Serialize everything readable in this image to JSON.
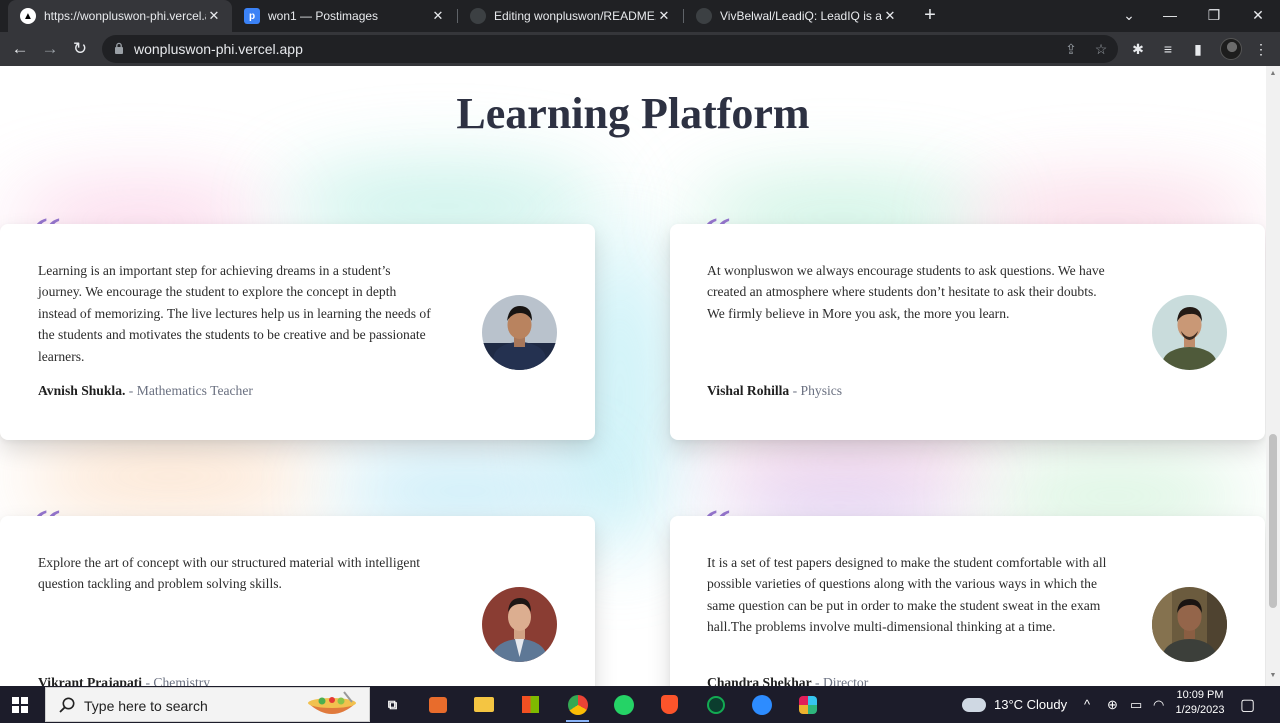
{
  "browser": {
    "tabs": [
      {
        "title": "https://wonpluswon-phi.vercel.ap",
        "active": true,
        "favicon": "vercel-icon"
      },
      {
        "title": "won1 — Postimages",
        "active": false,
        "favicon": "postimages-icon"
      },
      {
        "title": "Editing wonpluswon/README.md",
        "active": false,
        "favicon": "github-icon"
      },
      {
        "title": "VivBelwal/LeadiQ: LeadIQ is a pla",
        "active": false,
        "favicon": "github-icon"
      }
    ],
    "url": "wonpluswon-phi.vercel.app"
  },
  "page": {
    "title": "Learning Platform",
    "quote_mark": "“",
    "testimonials": [
      {
        "text": "Learning is an important step for achieving dreams in a student’s journey. We encourage the student to explore the concept in depth instead of memorizing. The live lectures help us in learning the needs of the students and motivates the students to be creative and be passionate learners.",
        "name": "Avnish Shukla.",
        "role": " - Mathematics Teacher"
      },
      {
        "text": "At wonpluswon we always encourage students to ask questions. We have created an atmosphere where students don’t hesitate to ask their doubts. We firmly believe in More you ask, the more you learn.",
        "name": "Vishal Rohilla",
        "role": " - Physics"
      },
      {
        "text": "Explore the art of concept with our structured material with intelligent question tackling and problem solving skills.",
        "name": "Vikrant Prajapati",
        "role": " - Chemistry"
      },
      {
        "text": "It is a set of test papers designed to make the student comfortable with all possible varieties of questions along with the various ways in which the same question can be put in order to make the student sweat in the exam hall.The problems involve multi-dimensional thinking at a time.",
        "name": "Chandra Shekhar",
        "role": " - Director"
      }
    ]
  },
  "taskbar": {
    "search_placeholder": "Type here to search",
    "weather": "13°C  Cloudy",
    "time": "10:09 PM",
    "date": "1/29/2023"
  }
}
